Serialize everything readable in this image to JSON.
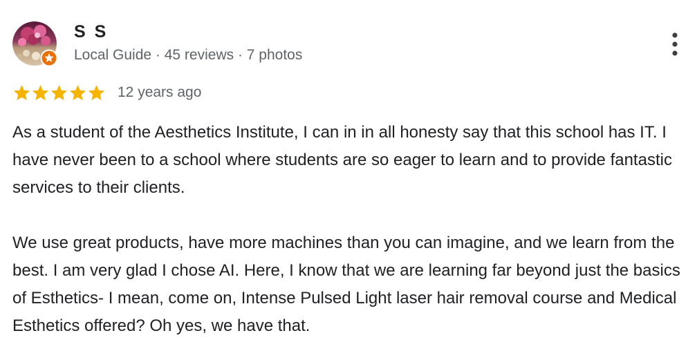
{
  "reviewer": {
    "name": "S S",
    "meta": "Local Guide · 45 reviews · 7 photos",
    "avatar_icon": "user-photo-avatar",
    "badge_icon": "local-guide-star-badge"
  },
  "review": {
    "rating": 5,
    "rating_max": 5,
    "date": "12 years ago",
    "paragraphs": [
      "As a student of the Aesthetics Institute, I can in in all honesty say that this school has IT. I have never been to a school where students are so eager to learn and to provide fantastic services to their clients.",
      "We use great products, have more machines than you can imagine, and we learn from the best. I am very glad I chose AI. Here, I know that we are learning far beyond just the basics of Esthetics- I mean, come on, Intense Pulsed Light laser hair removal course and Medical Esthetics offered? Oh yes, we have that."
    ]
  },
  "actions": {
    "more_icon": "more-vertical-icon"
  },
  "colors": {
    "star": "#f4b400",
    "badge": "#e8710a",
    "text_primary": "#202124",
    "text_secondary": "#5f6368"
  }
}
